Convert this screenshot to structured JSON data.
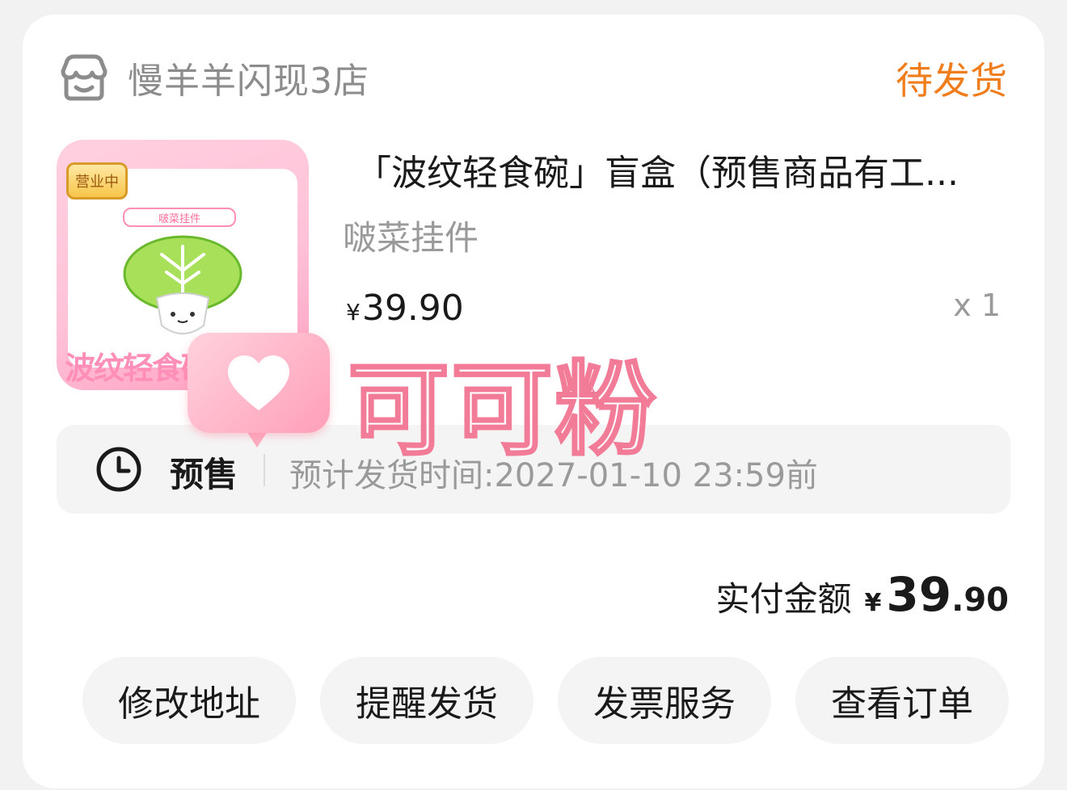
{
  "shop": {
    "icon": "shop-icon",
    "name": "慢羊羊闪现3店"
  },
  "order": {
    "status": "待发货"
  },
  "product": {
    "title": "「波纹轻食碗」盲盒（预售商品有工...",
    "variant": "啵菜挂件",
    "price_symbol": "¥",
    "price": "39.90",
    "quantity": "x 1",
    "thumbnail": {
      "badge": "营业中",
      "label": "啵菜挂件",
      "footer": "波纹轻食碗"
    }
  },
  "presale": {
    "icon": "clock-icon",
    "label": "预售",
    "ship_time": "预计发货时间:2027-01-10 23:59前"
  },
  "total": {
    "label": "实付金额",
    "symbol": "¥",
    "integer": "39",
    "decimal": ".90"
  },
  "actions": {
    "modify_address": "修改地址",
    "remind_shipping": "提醒发货",
    "invoice_service": "发票服务",
    "view_order": "查看订单"
  },
  "watermark": {
    "text": "可可粉",
    "icon": "heart-icon"
  },
  "colors": {
    "status": "#f07d1c",
    "accent_pink": "#f27c98"
  }
}
